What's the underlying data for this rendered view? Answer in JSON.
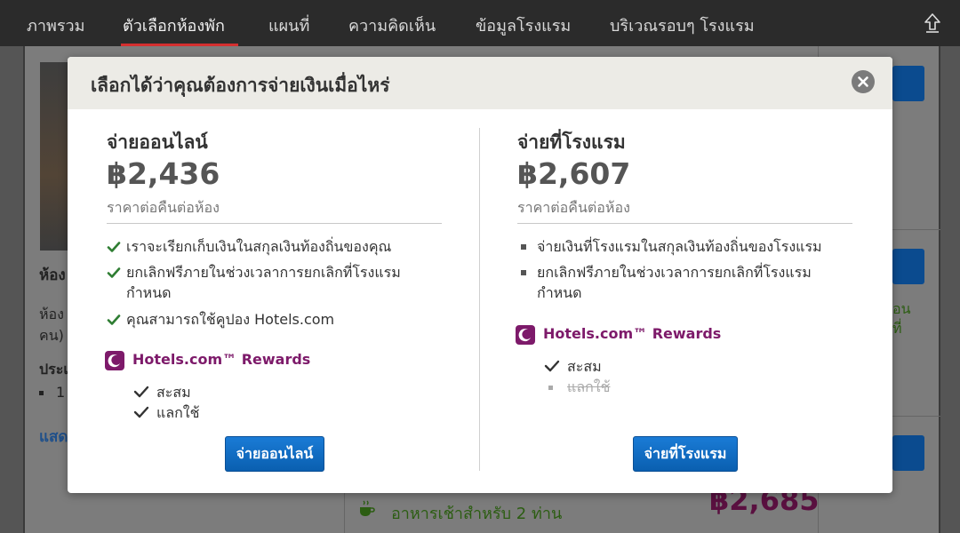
{
  "nav": {
    "tabs": [
      {
        "label": "ภาพรวม"
      },
      {
        "label": "ตัวเลือกห้องพัก"
      },
      {
        "label": "แผนที่"
      },
      {
        "label": "ความคิดเห็น"
      },
      {
        "label": "ข้อมูลโรงแรม"
      },
      {
        "label": "บริเวณรอบๆ โรงแรม"
      }
    ],
    "active_tab": 1,
    "accent_color": "#d32f2f"
  },
  "background": {
    "room_label": "ห้อง",
    "room_sub": "ห้อง",
    "room_sub2": "คน)",
    "type_label": "ประเ",
    "bullet": "1",
    "show_more": "แสด",
    "green_1": "อน",
    "green_2": "ที่",
    "breakfast": "อาหารเช้าสำหรับ 2 ท่าน",
    "price": "฿2,685"
  },
  "modal": {
    "title": "เลือกได้ว่าคุณต้องการจ่ายเงินเมื่อไหร่",
    "close_icon": "close-icon",
    "online": {
      "title": "จ่ายออนไลน์",
      "price": "฿2,436",
      "price_note": "ราคาต่อคืนต่อห้อง",
      "features": [
        "เราจะเรียกเก็บเงินในสกุลเงินท้องถิ่นของคุณ",
        "ยกเลิกฟรีภายในช่วงเวลาการยกเลิกที่โรงแรมกำหนด",
        "คุณสามารถใช้คูปอง Hotels.com"
      ],
      "rewards_name": "Hotels.com™ Rewards",
      "rewards_items": [
        "สะสม",
        "แลกใช้"
      ],
      "button": "จ่ายออนไลน์"
    },
    "hotel": {
      "title": "จ่ายที่โรงแรม",
      "price": "฿2,607",
      "price_note": "ราคาต่อคืนต่อห้อง",
      "features": [
        "จ่ายเงินที่โรงแรมในสกุลเงินท้องถิ่นของโรงแรม",
        "ยกเลิกฟรีภายในช่วงเวลาการยกเลิกที่โรงแรมกำหนด"
      ],
      "rewards_name": "Hotels.com™ Rewards",
      "rewards_items": [
        "สะสม",
        "แลกใช้"
      ],
      "button": "จ่ายที่โรงแรม"
    },
    "colors": {
      "rewards": "#7d1a6a",
      "check": "#2e7d32",
      "button": "#0a5fb0"
    }
  }
}
